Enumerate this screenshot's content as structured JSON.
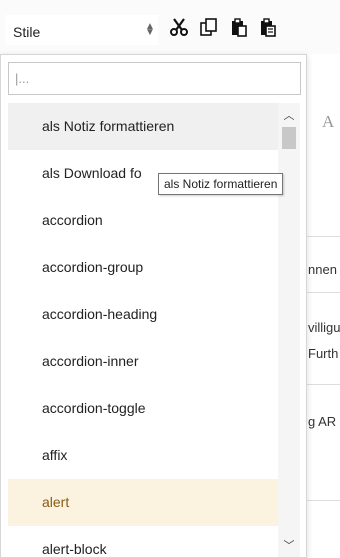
{
  "toolbar": {
    "style_select_label": "Stile",
    "icons": [
      "scissors-icon",
      "copy-icon",
      "paste-icon",
      "paste-text-icon"
    ]
  },
  "editor_background": {
    "format_glyph": "A",
    "snippets": [
      "nnen",
      "villigu",
      "Furth",
      "g AR"
    ]
  },
  "dropdown": {
    "search_value": "|...",
    "items": [
      "als Notiz formattieren",
      "als Download fo",
      "accordion",
      "accordion-group",
      "accordion-heading",
      "accordion-inner",
      "accordion-toggle",
      "affix",
      "alert",
      "alert-block"
    ],
    "hover_item": "als Notiz formattieren",
    "selected_item": "alert"
  },
  "tooltip": {
    "text": "als Notiz formattieren"
  },
  "colors": {
    "selected_bg": "#fbf3e0",
    "selected_text": "#8a5a14",
    "hover_bg": "#f0f0f0"
  }
}
